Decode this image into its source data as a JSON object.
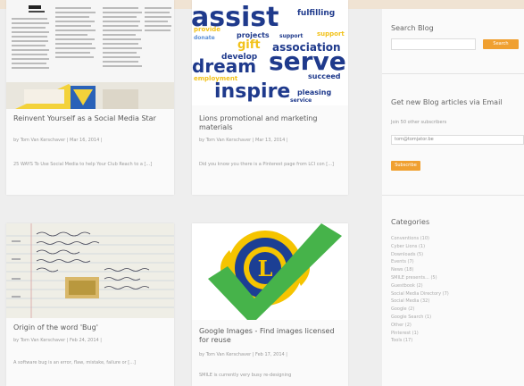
{
  "posts": [
    {
      "title": "Reinvent Yourself as a Social Media Star",
      "meta": "by Tom Van Kerschaver | Mar 16, 2014 |",
      "excerpt": "25 WAYS To Use Social Media to help Your Club Reach to a [...]",
      "thumb_icon": "document-scan-icon"
    },
    {
      "title": "Lions promotional and marketing materials",
      "meta": "by Tom Van Kerschaver | Mar 13, 2014 |",
      "excerpt": "Did you know you there is a Pinterest page from LCI con [...]",
      "thumb_icon": "word-cloud-icon",
      "word_cloud": {
        "words": [
          "assist",
          "fulfilling",
          "projects",
          "support",
          "gift",
          "association",
          "develop",
          "dream",
          "serve",
          "succeed",
          "inspire",
          "pleasing",
          "service",
          "donate",
          "provide",
          "employment",
          "support"
        ],
        "colors": {
          "blue": "#1f3a8c",
          "yellow": "#f2c21a",
          "light_blue": "#5c8fd6"
        }
      }
    },
    {
      "title": "Origin of the word 'Bug'",
      "meta": "by Tom Van Kerschaver | Feb 24, 2014 |",
      "excerpt": "A software bug is an error, flaw, mistake, failure or [...]",
      "thumb_icon": "notebook-page-icon"
    },
    {
      "title": "Google Images - Find images licensed for reuse",
      "meta": "by Tom Van Kerschaver | Feb 17, 2014 |",
      "excerpt": "SMILE is currently very busy re-designing",
      "thumb_icon": "lions-logo-checkmark-icon",
      "logo_letter": "L"
    }
  ],
  "sidebar": {
    "search_heading": "Search Blog",
    "search_button": "Search",
    "subscribe_heading": "Get new Blog articles via Email",
    "subscribers_text": "Join 50 other subscribers",
    "email_value": "tom@tomjator.be",
    "subscribe_button": "Subscribe",
    "categories_heading": "Categories",
    "categories": [
      "Conventions (10)",
      "Cyber Lions (1)",
      "Downloads (5)",
      "Events (7)",
      "News (18)",
      "SMILE presents... (5)",
      "Guestbook (2)",
      "Social Media Directory (7)",
      "Social Media (32)",
      "Google (2)",
      "Google Search (1)",
      "Other (2)",
      "Pinterest (1)",
      "Tools (17)"
    ]
  },
  "colors": {
    "accent": "#f0a030",
    "lions_blue": "#1c3f94",
    "lions_gold": "#f5c400",
    "check_green": "#46b34a"
  }
}
